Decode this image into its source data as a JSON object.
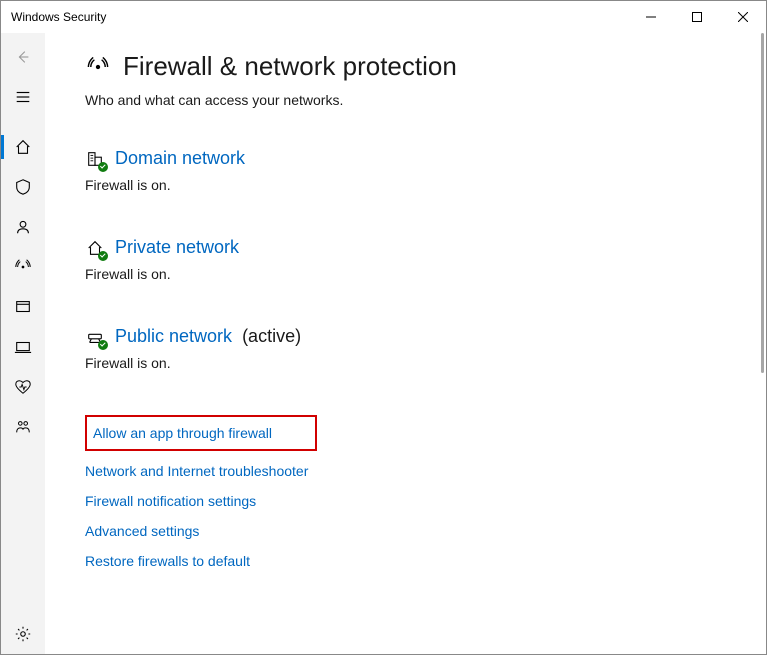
{
  "app_title": "Windows Security",
  "page": {
    "title": "Firewall & network protection",
    "subtitle": "Who and what can access your networks."
  },
  "networks": [
    {
      "icon": "domain",
      "label": "Domain network",
      "status": "Firewall is on.",
      "active": false
    },
    {
      "icon": "private",
      "label": "Private network",
      "status": "Firewall is on.",
      "active": false
    },
    {
      "icon": "public",
      "label": "Public network",
      "status": "Firewall is on.",
      "active": true,
      "active_label": "(active)"
    }
  ],
  "actions": [
    {
      "label": "Allow an app through firewall",
      "highlighted": true
    },
    {
      "label": "Network and Internet troubleshooter"
    },
    {
      "label": "Firewall notification settings"
    },
    {
      "label": "Advanced settings"
    },
    {
      "label": "Restore firewalls to default"
    }
  ]
}
